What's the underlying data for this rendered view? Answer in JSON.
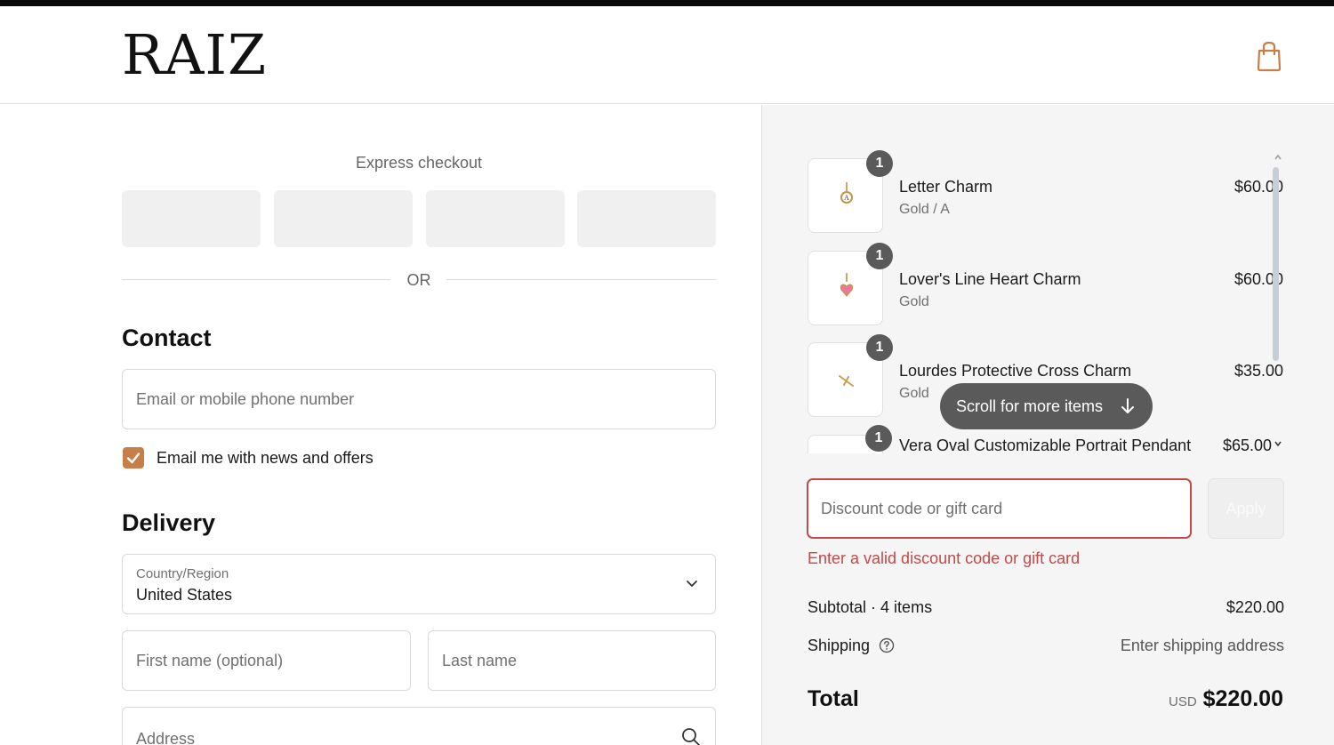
{
  "header": {
    "logo": "RAIZ",
    "cart_icon": "shopping-bag-icon",
    "accent_color": "#c77f47"
  },
  "express": {
    "title": "Express checkout",
    "or": "OR"
  },
  "contact": {
    "title": "Contact",
    "email_placeholder": "Email or mobile phone number",
    "newsletter_label": "Email me with news and offers",
    "newsletter_checked": true
  },
  "delivery": {
    "title": "Delivery",
    "country_label": "Country/Region",
    "country_value": "United States",
    "first_name_placeholder": "First name (optional)",
    "last_name_placeholder": "Last name",
    "address_placeholder": "Address"
  },
  "order": {
    "items": [
      {
        "qty": "1",
        "name": "Letter Charm",
        "variant": "Gold / A",
        "price": "$60.00"
      },
      {
        "qty": "1",
        "name": "Lover's Line Heart Charm",
        "variant": "Gold",
        "price": "$60.00"
      },
      {
        "qty": "1",
        "name": "Lourdes Protective Cross Charm",
        "variant": "Gold",
        "price": "$35.00"
      },
      {
        "qty": "1",
        "name": "Vera Oval Customizable Portrait Pendant",
        "variant": "",
        "price": "$65.00"
      }
    ],
    "scroll_hint": "Scroll for more items",
    "discount_placeholder": "Discount code or gift card",
    "apply_label": "Apply",
    "discount_error": "Enter a valid discount code or gift card",
    "subtotal_label": "Subtotal · 4 items",
    "subtotal_value": "$220.00",
    "shipping_label": "Shipping",
    "shipping_value": "Enter shipping address",
    "total_label": "Total",
    "total_currency": "USD",
    "total_value": "$220.00",
    "error_color": "#c14a4a"
  }
}
